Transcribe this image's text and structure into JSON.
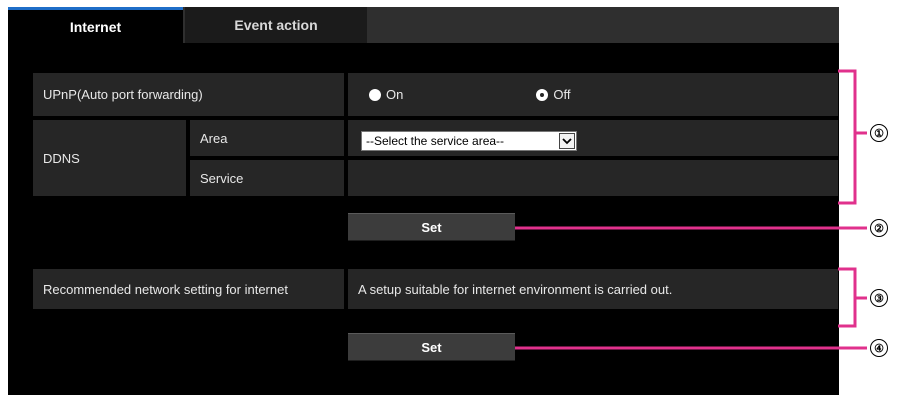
{
  "tabs": [
    {
      "label": "Internet",
      "active": true
    },
    {
      "label": "Event action",
      "active": false
    }
  ],
  "upnp": {
    "label": "UPnP(Auto port forwarding)",
    "options": [
      {
        "label": "On",
        "selected": false
      },
      {
        "label": "Off",
        "selected": true
      }
    ]
  },
  "ddns": {
    "label": "DDNS",
    "area_label": "Area",
    "area_select_value": "--Select the service area--",
    "service_label": "Service",
    "service_value": ""
  },
  "set_button_1": "Set",
  "recommended": {
    "label": "Recommended network setting for internet",
    "description": "A setup suitable for internet environment is carried out."
  },
  "set_button_2": "Set",
  "callouts": [
    "①",
    "②",
    "③",
    "④"
  ],
  "colors": {
    "panel_bg": "#000000",
    "cell_bg": "#262626",
    "button_bg": "#3c3c3c",
    "active_tab_accent": "#1f6ec8",
    "annotation_line": "#e0318c"
  }
}
